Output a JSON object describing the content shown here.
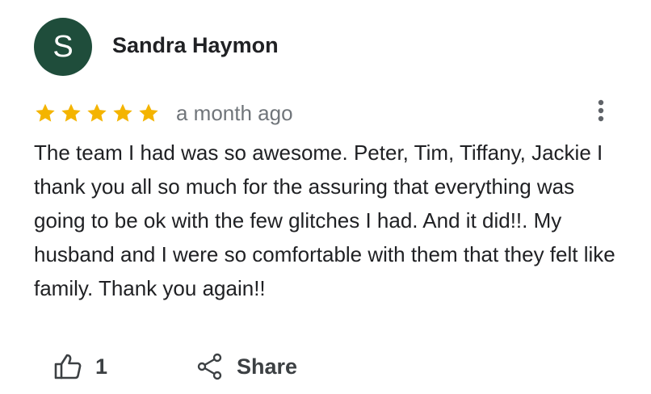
{
  "review": {
    "author": {
      "initial": "S",
      "name": "Sandra Haymon",
      "avatar_color": "#1f4d3b"
    },
    "rating": {
      "stars": 5,
      "max_stars": 5,
      "star_color": "#f4b400",
      "star_icon": "star-icon"
    },
    "date": "a month ago",
    "text": "The team I had was so awesome. Peter, Tim, Tiffany, Jackie I thank you all so much for the assuring that everything was going to be ok with the few glitches I had. And it did!!. My husband and I were so comfortable with them that they felt like family. Thank you again!!",
    "actions": {
      "like_icon": "thumbs-up-icon",
      "like_count": "1",
      "share_icon": "share-icon",
      "share_label": "Share",
      "more_icon": "more-vert-icon"
    }
  }
}
